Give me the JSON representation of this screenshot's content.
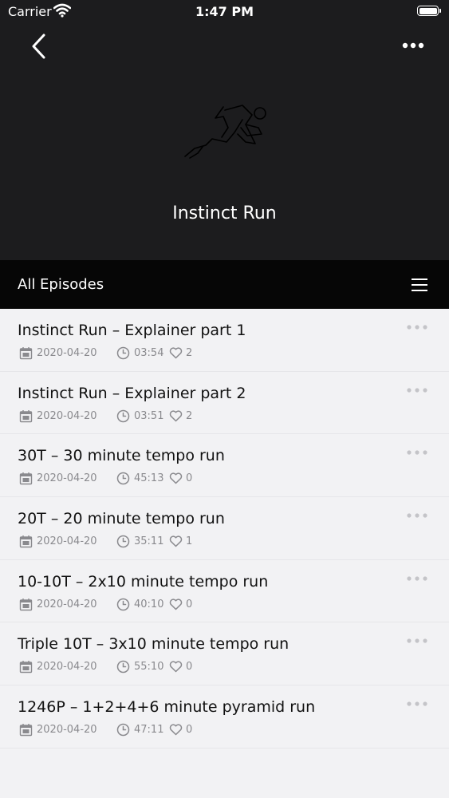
{
  "status_bar": {
    "carrier": "Carrier",
    "time": "1:47 PM"
  },
  "header": {
    "back_icon": "chevron-left-icon",
    "more_icon": "ellipsis-icon",
    "logo_icon": "running-figure-icon",
    "title": "Instinct Run"
  },
  "section": {
    "title": "All Episodes",
    "menu_icon": "hamburger-menu-icon"
  },
  "icons": {
    "date": "calendar-icon",
    "duration": "clock-icon",
    "likes": "heart-icon",
    "more": "ellipsis-icon"
  },
  "colors": {
    "header_bg": "#1c1c1e",
    "section_bar_bg": "#060606",
    "list_bg": "#f2f2f4",
    "meta_text": "#8a8a8e"
  },
  "episodes": [
    {
      "title": "Instinct Run – Explainer part 1",
      "date": "2020-04-20",
      "duration": "03:54",
      "likes": "2"
    },
    {
      "title": "Instinct Run – Explainer part 2",
      "date": "2020-04-20",
      "duration": "03:51",
      "likes": "2"
    },
    {
      "title": "30T – 30 minute tempo run",
      "date": "2020-04-20",
      "duration": "45:13",
      "likes": "0"
    },
    {
      "title": "20T – 20 minute tempo run",
      "date": "2020-04-20",
      "duration": "35:11",
      "likes": "1"
    },
    {
      "title": "10-10T – 2x10 minute tempo run",
      "date": "2020-04-20",
      "duration": "40:10",
      "likes": "0"
    },
    {
      "title": "Triple 10T – 3x10 minute tempo run",
      "date": "2020-04-20",
      "duration": "55:10",
      "likes": "0"
    },
    {
      "title": "1246P – 1+2+4+6 minute pyramid run",
      "date": "2020-04-20",
      "duration": "47:11",
      "likes": "0"
    }
  ]
}
